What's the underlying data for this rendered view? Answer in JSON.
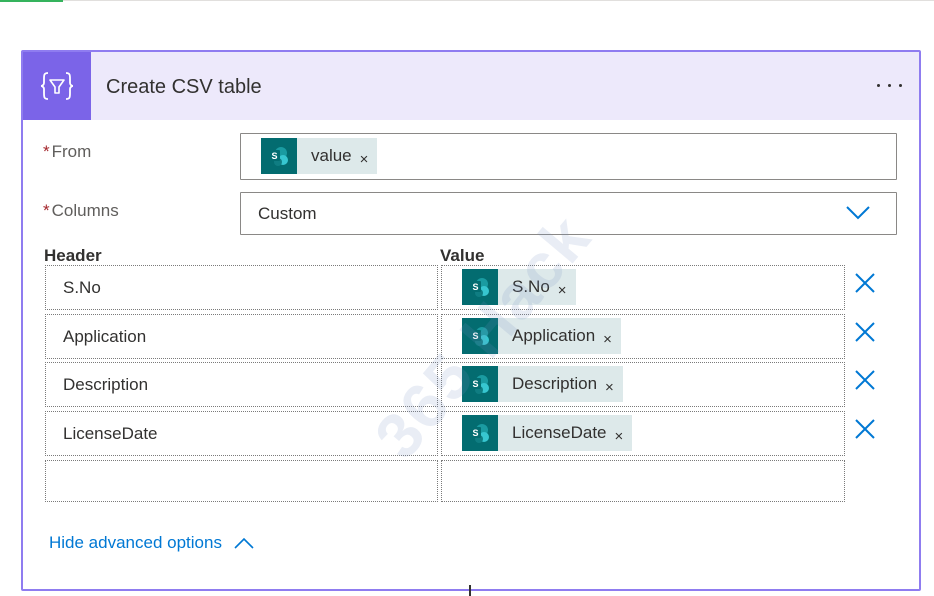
{
  "card": {
    "title": "Create CSV table",
    "icon": "data-operation-icon",
    "accent_color": "#7b64e8",
    "border_color": "#8f7cf0"
  },
  "from": {
    "label": "From",
    "required_mark": "*",
    "token": {
      "icon": "sharepoint-icon",
      "text": "value"
    }
  },
  "columns": {
    "label": "Columns",
    "required_mark": "*",
    "selected": "Custom"
  },
  "table": {
    "header_label": "Header",
    "value_label": "Value",
    "rows": [
      {
        "header": "S.No",
        "value": "S.No"
      },
      {
        "header": "Application",
        "value": "Application"
      },
      {
        "header": "Description",
        "value": "Description"
      },
      {
        "header": "LicenseDate",
        "value": "LicenseDate"
      },
      {
        "header": "",
        "value": ""
      }
    ]
  },
  "advanced": {
    "label": "Hide advanced options"
  },
  "watermark": "365 Hack",
  "token_close_glyph": "×"
}
